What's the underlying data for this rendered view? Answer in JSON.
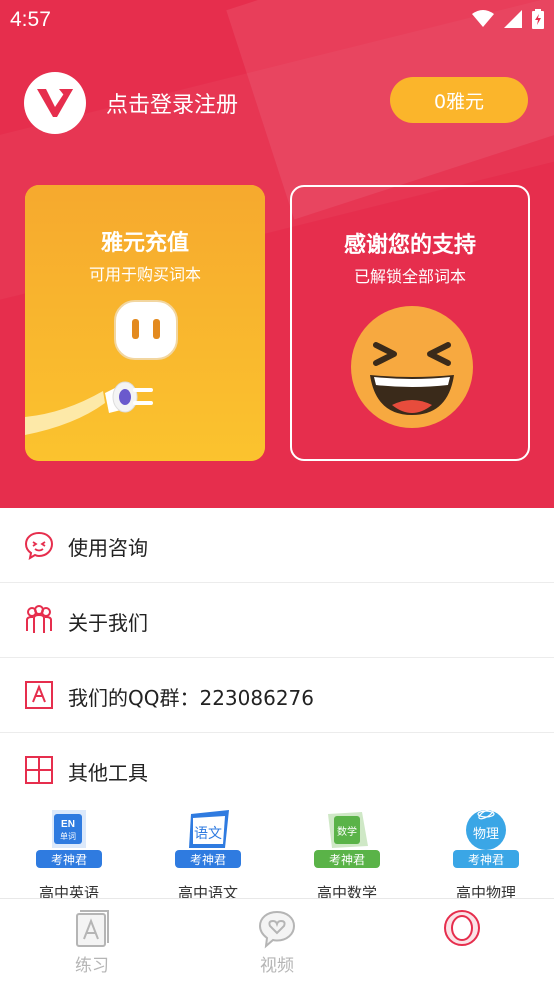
{
  "status_bar": {
    "time": "4:57"
  },
  "profile": {
    "login_text": "点击登录注册",
    "coin_button": "0雅元"
  },
  "cards": {
    "recharge": {
      "title": "雅元充值",
      "subtitle": "可用于购买词本"
    },
    "thanks": {
      "title": "感谢您的支持",
      "subtitle": "已解锁全部词本"
    }
  },
  "menu": {
    "items": [
      {
        "label": "使用咨询",
        "icon": "chat-icon"
      },
      {
        "label": "关于我们",
        "icon": "people-icon"
      },
      {
        "label": "我们的QQ群：223086276",
        "icon": "letter-a-icon"
      },
      {
        "label": "其他工具",
        "icon": "grid-icon"
      }
    ]
  },
  "tools": [
    {
      "badge_main": "EN",
      "badge_sub": "单词",
      "brand": "考神君",
      "label": "高中英语",
      "color": "#2f7be0"
    },
    {
      "badge_main": "语文",
      "badge_sub": "",
      "brand": "考神君",
      "label": "高中语文",
      "color": "#2f7be0"
    },
    {
      "badge_main": "数学",
      "badge_sub": "",
      "brand": "考神君",
      "label": "高中数学",
      "color": "#5ab348"
    },
    {
      "badge_main": "物理",
      "badge_sub": "",
      "brand": "考神君",
      "label": "高中物理",
      "color": "#3aa6e6"
    }
  ],
  "tabbar": {
    "tabs": [
      {
        "label": "练习",
        "icon": "book-icon"
      },
      {
        "label": "视频",
        "icon": "heart-chat-icon"
      },
      {
        "label": "",
        "icon": "profile-circle-icon"
      }
    ]
  },
  "colors": {
    "brand_red": "#e62e4d",
    "coin_orange": "#fbb52b",
    "card_orange": "#f7a92f"
  }
}
